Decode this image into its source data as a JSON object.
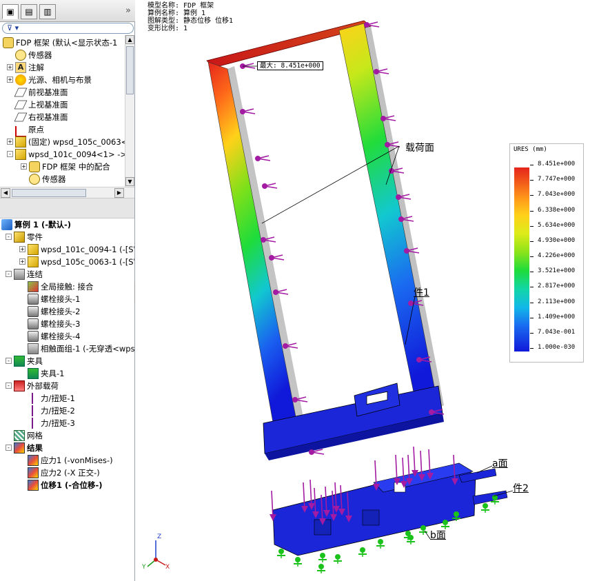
{
  "left_panel": {
    "tabs": [
      "feature-manager",
      "property-manager",
      "configuration-manager"
    ],
    "collapse_glyph": "»",
    "filter_glyph": "▾",
    "feature_tree": [
      {
        "label": "FDP 框架  (默认<显示状态-1",
        "icon": "assembly",
        "exp": ""
      },
      {
        "label": "传感器",
        "icon": "sensor",
        "exp": ""
      },
      {
        "label": "注解",
        "icon": "annotation",
        "exp": "+"
      },
      {
        "label": "光源、相机与布景",
        "icon": "light",
        "exp": "+"
      },
      {
        "label": "前视基准面",
        "icon": "plane",
        "exp": ""
      },
      {
        "label": "上视基准面",
        "icon": "plane",
        "exp": ""
      },
      {
        "label": "右视基准面",
        "icon": "plane",
        "exp": ""
      },
      {
        "label": "原点",
        "icon": "origin",
        "exp": ""
      },
      {
        "label": "(固定) wpsd_105c_0063<1",
        "icon": "part",
        "exp": "+"
      },
      {
        "label": "wpsd_101c_0094<1> ->",
        "icon": "part",
        "exp": "-"
      },
      {
        "label": "FDP 框架 中的配合",
        "icon": "mates",
        "exp": "+"
      },
      {
        "label": "传感器",
        "icon": "sensor",
        "exp": ""
      }
    ],
    "study_tree": [
      {
        "label": "算例 1 (-默认-)",
        "icon": "study",
        "bold": true,
        "exp": ""
      },
      {
        "label": "零件",
        "icon": "parts",
        "exp": "-"
      },
      {
        "label": "wpsd_101c_0094-1 (-[SW]",
        "icon": "part",
        "exp": "+"
      },
      {
        "label": "wpsd_105c_0063-1 (-[SW]",
        "icon": "part",
        "exp": "+"
      },
      {
        "label": "连结",
        "icon": "connections",
        "exp": "-"
      },
      {
        "label": "全局接触: 接合",
        "icon": "contact",
        "exp": ""
      },
      {
        "label": "螺栓接头-1",
        "icon": "bolt",
        "exp": ""
      },
      {
        "label": "螺栓接头-2",
        "icon": "bolt",
        "exp": ""
      },
      {
        "label": "螺栓接头-3",
        "icon": "bolt",
        "exp": ""
      },
      {
        "label": "螺栓接头-4",
        "icon": "bolt",
        "exp": ""
      },
      {
        "label": "相触面组-1 (-无穿透<wps",
        "icon": "contact-set",
        "exp": ""
      },
      {
        "label": "夹具",
        "icon": "fixtures",
        "exp": "-"
      },
      {
        "label": "夹具-1",
        "icon": "fixture",
        "exp": ""
      },
      {
        "label": "外部载荷",
        "icon": "loads",
        "exp": "-"
      },
      {
        "label": "力/扭矩-1",
        "icon": "force",
        "exp": ""
      },
      {
        "label": "力/扭矩-2",
        "icon": "force",
        "exp": ""
      },
      {
        "label": "力/扭矩-3",
        "icon": "force",
        "exp": ""
      },
      {
        "label": "网格",
        "icon": "mesh",
        "exp": ""
      },
      {
        "label": "结果",
        "icon": "results",
        "bold": true,
        "exp": "-"
      },
      {
        "label": "应力1 (-vonMises-)",
        "icon": "result-plot",
        "exp": ""
      },
      {
        "label": "应力2 (-X 正交-)",
        "icon": "result-plot",
        "exp": ""
      },
      {
        "label": "位移1 (-合位移-)",
        "icon": "result-plot",
        "bold": true,
        "exp": ""
      }
    ]
  },
  "viewport": {
    "info_lines": [
      "模型名称: FDP 框架",
      "算例名称: 算例 1",
      "图解类型: 静态位移 位移1",
      "变形比例: 1"
    ],
    "max_tip": "最大:  8.451e+000",
    "annotations": {
      "load_face": "载荷面",
      "part1": "件1",
      "part2": "件2",
      "face_a": "a面",
      "face_b": "b面"
    },
    "legend": {
      "title": "URES (mm)",
      "ticks": [
        "8.451e+000",
        "7.747e+000",
        "7.043e+000",
        "6.338e+000",
        "5.634e+000",
        "4.930e+000",
        "4.226e+000",
        "3.521e+000",
        "2.817e+000",
        "2.113e+000",
        "1.409e+000",
        "7.043e-001",
        "1.000e-030"
      ]
    },
    "triad": {
      "x": "X",
      "y": "Y",
      "z": "Z"
    },
    "colors": {
      "max": "#e4251c",
      "min": "#1019d9",
      "load_arrows": "#a31aa3",
      "fixtures": "#1cc21c"
    }
  }
}
